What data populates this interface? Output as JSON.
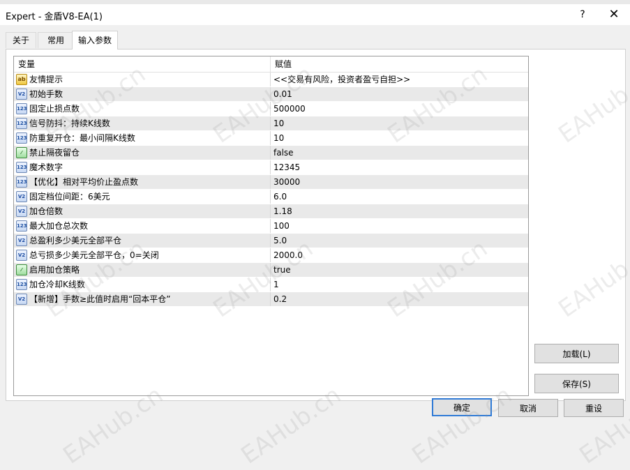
{
  "window": {
    "title": "Expert - 金盾V8-EA(1)",
    "help_label": "?",
    "close_label": "✕"
  },
  "tabs": [
    {
      "label": "关于"
    },
    {
      "label": "常用"
    },
    {
      "label": "输入参数",
      "active": true
    }
  ],
  "table": {
    "header_variable": "变量",
    "header_value": "赋值",
    "rows": [
      {
        "icon": "ab",
        "name": "友情提示",
        "value": "<<交易有风险，投资者盈亏自担>>"
      },
      {
        "icon": "v2",
        "name": "初始手数",
        "value": "0.01"
      },
      {
        "icon": "123",
        "name": "固定止损点数",
        "value": "500000"
      },
      {
        "icon": "123",
        "name": "信号防抖：持续K线数",
        "value": "10"
      },
      {
        "icon": "123",
        "name": "防重复开仓：最小间隔K线数",
        "value": "10"
      },
      {
        "icon": "bool",
        "name": "禁止隔夜留仓",
        "value": "false"
      },
      {
        "icon": "123",
        "name": "魔术数字",
        "value": "12345"
      },
      {
        "icon": "123",
        "name": "【优化】相对平均价止盈点数",
        "value": "30000"
      },
      {
        "icon": "v2",
        "name": "固定档位间距：6美元",
        "value": "6.0"
      },
      {
        "icon": "v2",
        "name": "加仓倍数",
        "value": "1.18"
      },
      {
        "icon": "123",
        "name": "最大加仓总次数",
        "value": "100"
      },
      {
        "icon": "v2",
        "name": "总盈利多少美元全部平仓",
        "value": "5.0"
      },
      {
        "icon": "v2",
        "name": "总亏损多少美元全部平仓，0=关闭",
        "value": "2000.0"
      },
      {
        "icon": "bool",
        "name": "启用加仓策略",
        "value": "true"
      },
      {
        "icon": "123",
        "name": "加仓冷却K线数",
        "value": "1"
      },
      {
        "icon": "v2",
        "name": "【新增】手数≥此值时启用“回本平仓”",
        "value": "0.2"
      }
    ]
  },
  "buttons": {
    "load": "加载(L)",
    "save": "保存(S)",
    "ok": "确定",
    "cancel": "取消",
    "reset": "重设"
  },
  "watermark": "EAHub.cn",
  "icon_names": {
    "ab": "string-type-icon",
    "v2": "double-type-icon",
    "123": "integer-type-icon",
    "bool": "boolean-type-icon"
  }
}
